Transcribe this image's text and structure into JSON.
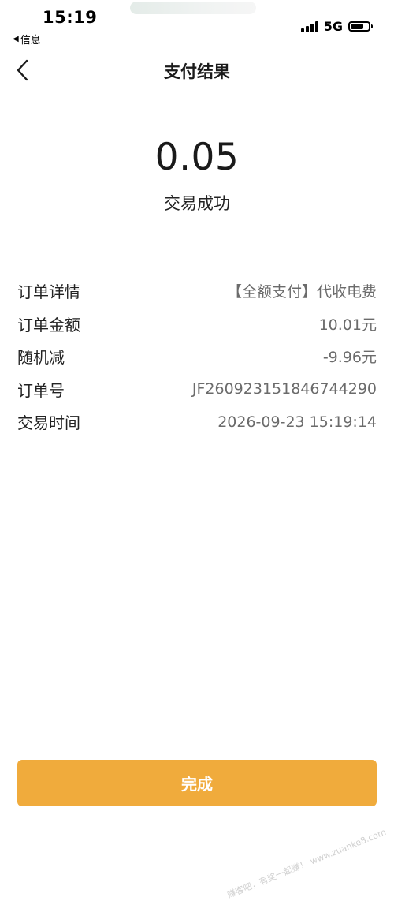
{
  "status_bar": {
    "time": "15:19",
    "back_app": "信息",
    "network": "5G"
  },
  "nav": {
    "title": "支付结果"
  },
  "result": {
    "amount": "0.05",
    "status": "交易成功"
  },
  "details": [
    {
      "label": "订单详情",
      "value": "【全额支付】代收电费"
    },
    {
      "label": "订单金额",
      "value": "10.01元"
    },
    {
      "label": "随机减",
      "value": "-9.96元"
    },
    {
      "label": "订单号",
      "value": "JF260923151846744290"
    },
    {
      "label": "交易时间",
      "value": "2026-09-23 15:19:14"
    }
  ],
  "footer": {
    "done_label": "完成"
  },
  "watermark": "赚客吧，有奖一起赚！ www.zuanke8.com",
  "colors": {
    "accent": "#f0ab3c",
    "text_primary": "#1a1a1a",
    "text_secondary": "#6b6b6b"
  },
  "icons": {
    "back": "chevron-left-icon",
    "signal": "signal-bars-icon",
    "battery": "battery-icon"
  }
}
